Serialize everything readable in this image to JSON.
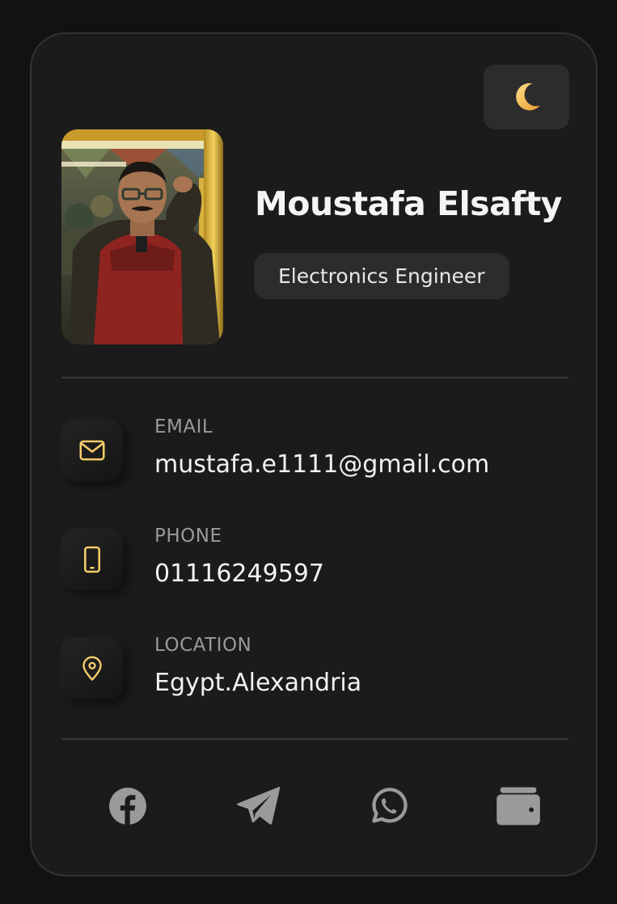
{
  "profile": {
    "name": "Moustafa Elsafty",
    "title": "Electronics Engineer",
    "photo_alt": "Profile photo"
  },
  "theme_toggle": {
    "icon": "crescent-moon-icon",
    "glyph": "🌙"
  },
  "contacts": [
    {
      "label": "EMAIL",
      "value": "mustafa.e1111@gmail.com",
      "icon": "mail-icon"
    },
    {
      "label": "PHONE",
      "value": "01116249597",
      "icon": "phone-icon"
    },
    {
      "label": "LOCATION",
      "value": "Egypt.Alexandria",
      "icon": "location-pin-icon"
    }
  ],
  "social": [
    {
      "icon": "facebook-icon"
    },
    {
      "icon": "telegram-icon"
    },
    {
      "icon": "whatsapp-icon"
    },
    {
      "icon": "wallet-icon"
    }
  ],
  "colors": {
    "background": "#121212",
    "card": "#1b1b1b",
    "accent": "#f5cd6a",
    "social_icon": "#9a9a9a"
  }
}
